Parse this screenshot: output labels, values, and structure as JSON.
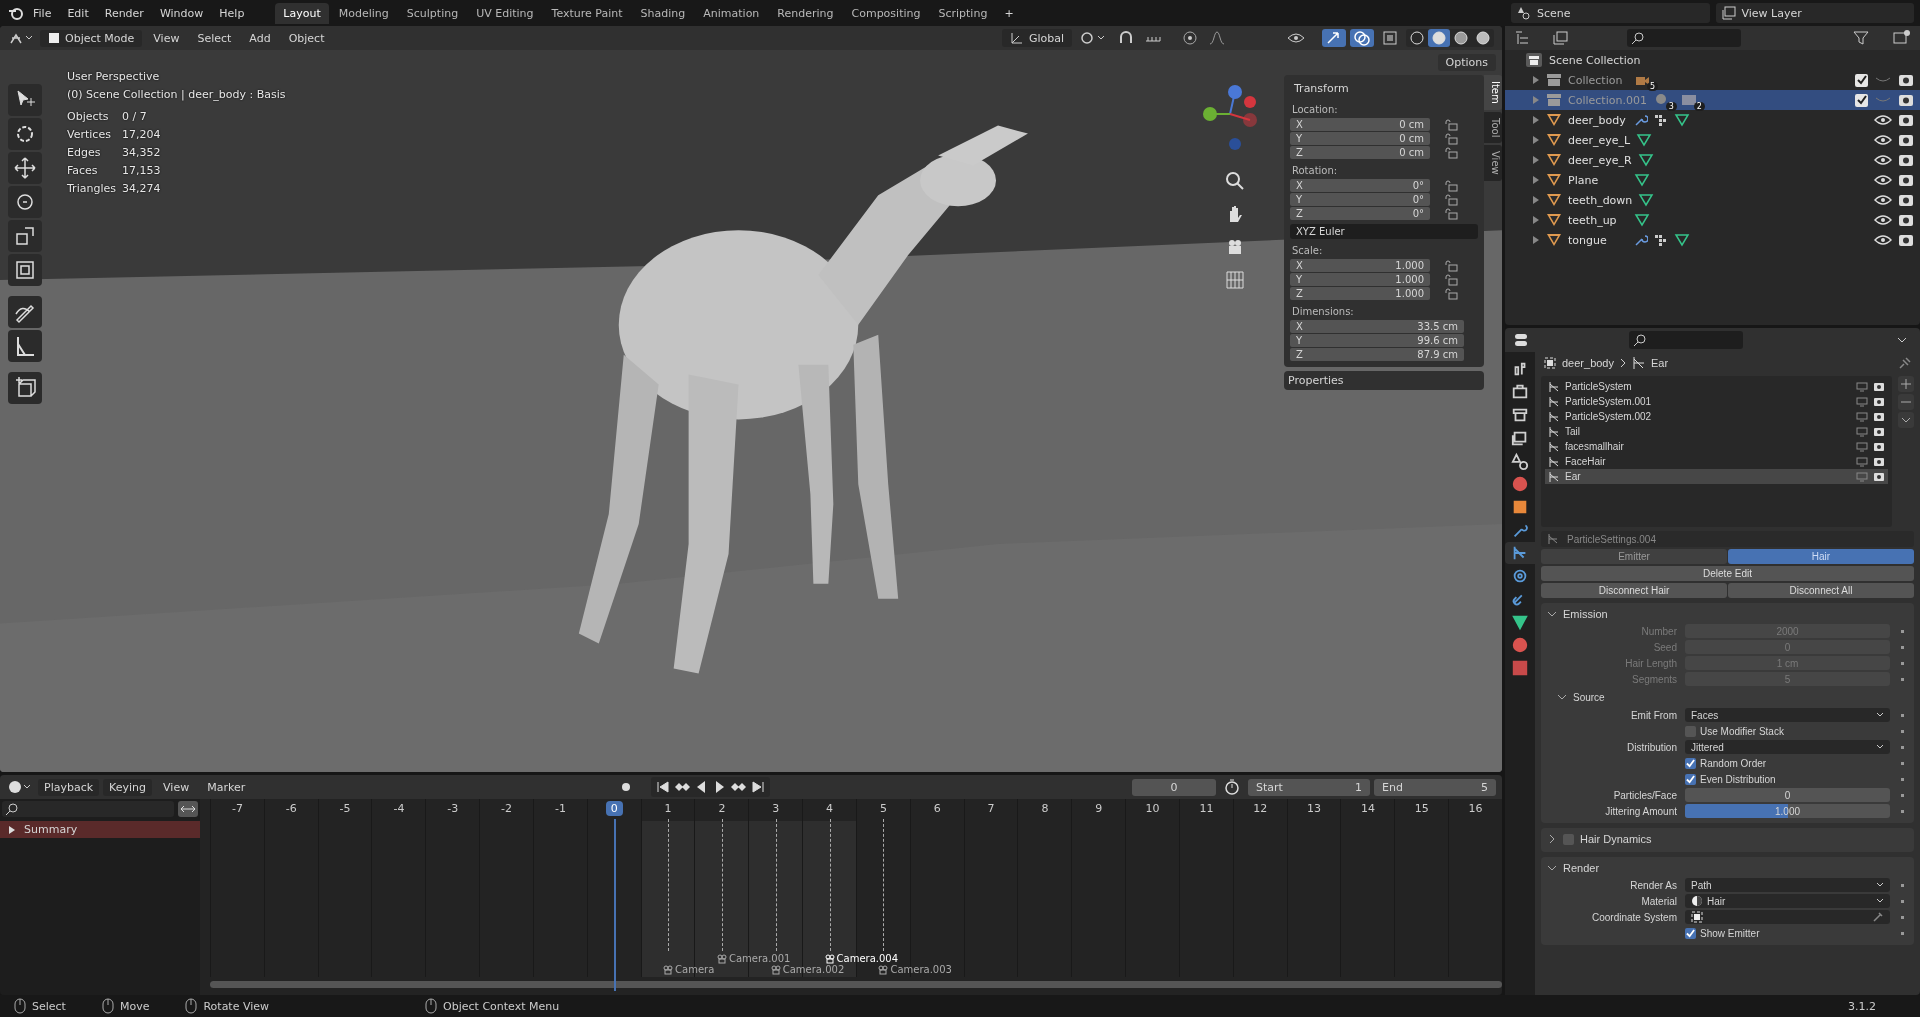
{
  "menu": [
    "File",
    "Edit",
    "Render",
    "Window",
    "Help"
  ],
  "workspaces": [
    {
      "label": "Layout",
      "selected": true
    },
    {
      "label": "Modeling",
      "selected": false
    },
    {
      "label": "Sculpting",
      "selected": false
    },
    {
      "label": "UV Editing",
      "selected": false
    },
    {
      "label": "Texture Paint",
      "selected": false
    },
    {
      "label": "Shading",
      "selected": false
    },
    {
      "label": "Animation",
      "selected": false
    },
    {
      "label": "Rendering",
      "selected": false
    },
    {
      "label": "Compositing",
      "selected": false
    },
    {
      "label": "Scripting",
      "selected": false
    }
  ],
  "add_workspace": "+",
  "scene": "Scene",
  "view_layer": "View Layer",
  "viewport_header": {
    "mode": "Object Mode",
    "menus": [
      "View",
      "Select",
      "Add",
      "Object"
    ],
    "orientation": "Global",
    "options": "Options",
    "shading": [
      {
        "kind": "wireframe",
        "selected": false
      },
      {
        "kind": "solid",
        "selected": true
      },
      {
        "kind": "material",
        "selected": false
      },
      {
        "kind": "rendered",
        "selected": false
      }
    ]
  },
  "viewport": {
    "perspective": "User Perspective",
    "context": "(0) Scene Collection | deer_body : Basis",
    "stats": [
      {
        "label": "Objects",
        "value": "0 / 7"
      },
      {
        "label": "Vertices",
        "value": "17,204"
      },
      {
        "label": "Edges",
        "value": "34,352"
      },
      {
        "label": "Faces",
        "value": "17,153"
      },
      {
        "label": "Triangles",
        "value": "34,274"
      }
    ]
  },
  "sidebar_tabs": [
    {
      "label": "Item",
      "selected": true
    },
    {
      "label": "Tool",
      "selected": false
    },
    {
      "label": "View",
      "selected": false
    }
  ],
  "transform": {
    "title": "Transform",
    "groups": [
      {
        "label": "Location:",
        "lock": true,
        "rows": [
          {
            "axis": "X",
            "value": "0 cm"
          },
          {
            "axis": "Y",
            "value": "0 cm"
          },
          {
            "axis": "Z",
            "value": "0 cm"
          }
        ]
      },
      {
        "label": "Rotation:",
        "lock": true,
        "rows": [
          {
            "axis": "X",
            "value": "0°"
          },
          {
            "axis": "Y",
            "value": "0°"
          },
          {
            "axis": "Z",
            "value": "0°"
          }
        ],
        "mode": "XYZ Euler"
      },
      {
        "label": "Scale:",
        "lock": true,
        "rows": [
          {
            "axis": "X",
            "value": "1.000"
          },
          {
            "axis": "Y",
            "value": "1.000"
          },
          {
            "axis": "Z",
            "value": "1.000"
          }
        ]
      },
      {
        "label": "Dimensions:",
        "lock": false,
        "rows": [
          {
            "axis": "X",
            "value": "33.5 cm"
          },
          {
            "axis": "Y",
            "value": "99.6 cm"
          },
          {
            "axis": "Z",
            "value": "87.9 cm"
          }
        ]
      }
    ]
  },
  "properties_panel": "Properties",
  "outliner": {
    "root": "Scene Collection",
    "items": [
      {
        "name": "Collection",
        "kind": "collection",
        "selected": false,
        "enabled": true,
        "badges": [
          {
            "kind": "camera",
            "count": "5"
          }
        ]
      },
      {
        "name": "Collection.001",
        "kind": "collection",
        "selected": true,
        "enabled": true,
        "badges": [
          {
            "kind": "light",
            "count": "3"
          },
          {
            "kind": "collection",
            "count": "2"
          }
        ]
      },
      {
        "name": "deer_body",
        "kind": "object",
        "selected": false,
        "modifiers": true
      },
      {
        "name": "deer_eye_L",
        "kind": "object",
        "selected": false,
        "modifiers": false
      },
      {
        "name": "deer_eye_R",
        "kind": "object",
        "selected": false,
        "modifiers": false
      },
      {
        "name": "Plane",
        "kind": "object",
        "selected": false,
        "modifiers": false
      },
      {
        "name": "teeth_down",
        "kind": "object",
        "selected": false,
        "modifiers": false
      },
      {
        "name": "teeth_up",
        "kind": "object",
        "selected": false,
        "modifiers": false
      },
      {
        "name": "tongue",
        "kind": "object",
        "selected": false,
        "modifiers": true
      }
    ]
  },
  "property_tabs": [
    {
      "kind": "tool",
      "selected": false
    },
    {
      "kind": "render",
      "selected": false
    },
    {
      "kind": "output",
      "selected": false
    },
    {
      "kind": "view_layer",
      "selected": false
    },
    {
      "kind": "scene",
      "selected": false
    },
    {
      "kind": "world",
      "selected": false
    },
    {
      "kind": "object",
      "selected": false
    },
    {
      "kind": "modifiers",
      "selected": false
    },
    {
      "kind": "particles",
      "selected": true
    },
    {
      "kind": "physics",
      "selected": false
    },
    {
      "kind": "constraints",
      "selected": false
    },
    {
      "kind": "data",
      "selected": false
    },
    {
      "kind": "material",
      "selected": false
    },
    {
      "kind": "texture",
      "selected": false
    }
  ],
  "breadcrumb": [
    "deer_body",
    "Ear"
  ],
  "particle_systems": [
    {
      "name": "ParticleSystem",
      "selected": false
    },
    {
      "name": "ParticleSystem.001",
      "selected": false
    },
    {
      "name": "ParticleSystem.002",
      "selected": false
    },
    {
      "name": "Tail",
      "selected": false
    },
    {
      "name": "facesmallhair",
      "selected": false
    },
    {
      "name": "FaceHair",
      "selected": false
    },
    {
      "name": "Ear",
      "selected": true
    }
  ],
  "particle_settings": "ParticleSettings.004",
  "particle_type": [
    {
      "label": "Emitter",
      "selected": false
    },
    {
      "label": "Hair",
      "selected": true
    }
  ],
  "edit_buttons": [
    "Delete Edit"
  ],
  "disconnect_buttons": [
    "Disconnect Hair",
    "Disconnect All"
  ],
  "sections": [
    {
      "title": "Emission",
      "expanded": true,
      "rows": [
        {
          "kind": "number",
          "label": "Number",
          "value": "2000",
          "disabled": true
        },
        {
          "kind": "number",
          "label": "Seed",
          "value": "0",
          "disabled": true
        },
        {
          "kind": "number",
          "label": "Hair Length",
          "value": "1 cm",
          "disabled": true
        },
        {
          "kind": "number",
          "label": "Segments",
          "value": "5",
          "disabled": true
        },
        {
          "kind": "subheader",
          "label": "Source",
          "expanded": true
        },
        {
          "kind": "dropdown",
          "label": "Emit From",
          "value": "Faces",
          "disabled": false
        },
        {
          "kind": "checkbox",
          "label": "Use Modifier Stack",
          "checked": false,
          "disabled": false
        },
        {
          "kind": "dropdown",
          "label": "Distribution",
          "value": "Jittered",
          "disabled": false
        },
        {
          "kind": "checkbox",
          "label": "Random Order",
          "checked": true,
          "disabled": false
        },
        {
          "kind": "checkbox",
          "label": "Even Distribution",
          "checked": true,
          "disabled": false
        },
        {
          "kind": "number",
          "label": "Particles/Face",
          "value": "0",
          "disabled": false
        },
        {
          "kind": "slider",
          "label": "Jittering Amount",
          "value": "1.000",
          "level": 0.5,
          "disabled": false
        }
      ]
    },
    {
      "title": "Hair Dynamics",
      "expanded": false,
      "checkbox": false
    },
    {
      "title": "Render",
      "expanded": true,
      "rows": [
        {
          "kind": "dropdown",
          "label": "Render As",
          "value": "Path",
          "disabled": false
        },
        {
          "kind": "material",
          "label": "Material",
          "value": "Hair",
          "disabled": false
        },
        {
          "kind": "object",
          "label": "Coordinate System",
          "disabled": false
        },
        {
          "kind": "checkbox",
          "label": "Show Emitter",
          "checked": true,
          "disabled": false
        }
      ]
    }
  ],
  "timeline": {
    "menus": [
      "Playback",
      "Keying",
      "View",
      "Marker"
    ],
    "current_frame": "0",
    "start_label": "Start",
    "start": "1",
    "end_label": "End",
    "end": "5",
    "channel": "Summary",
    "ticks": [
      {
        "label": "-7",
        "selected": false,
        "in_range": false
      },
      {
        "label": "-6",
        "selected": false,
        "in_range": false
      },
      {
        "label": "-5",
        "selected": false,
        "in_range": false
      },
      {
        "label": "-4",
        "selected": false,
        "in_range": false
      },
      {
        "label": "-3",
        "selected": false,
        "in_range": false
      },
      {
        "label": "-2",
        "selected": false,
        "in_range": false
      },
      {
        "label": "-1",
        "selected": false,
        "in_range": false
      },
      {
        "label": "0",
        "selected": true,
        "in_range": false
      },
      {
        "label": "1",
        "selected": false,
        "in_range": true,
        "marker": {
          "name": "Camera",
          "selected": false
        }
      },
      {
        "label": "2",
        "selected": false,
        "in_range": true,
        "marker": {
          "name": "Camera.001",
          "selected": false
        }
      },
      {
        "label": "3",
        "selected": false,
        "in_range": true,
        "marker": {
          "name": "Camera.002",
          "selected": false
        }
      },
      {
        "label": "4",
        "selected": false,
        "in_range": true,
        "marker": {
          "name": "Camera.004",
          "selected": true
        }
      },
      {
        "label": "5",
        "selected": false,
        "in_range": false,
        "marker": {
          "name": "Camera.003",
          "selected": false
        }
      },
      {
        "label": "6",
        "selected": false,
        "in_range": false
      },
      {
        "label": "7",
        "selected": false,
        "in_range": false
      },
      {
        "label": "8",
        "selected": false,
        "in_range": false
      },
      {
        "label": "9",
        "selected": false,
        "in_range": false
      },
      {
        "label": "10",
        "selected": false,
        "in_range": false
      },
      {
        "label": "11",
        "selected": false,
        "in_range": false
      },
      {
        "label": "12",
        "selected": false,
        "in_range": false
      },
      {
        "label": "13",
        "selected": false,
        "in_range": false
      },
      {
        "label": "14",
        "selected": false,
        "in_range": false
      },
      {
        "label": "15",
        "selected": false,
        "in_range": false
      },
      {
        "label": "16",
        "selected": false,
        "in_range": false
      }
    ]
  },
  "status_bar": {
    "hints": [
      "Select",
      "Move",
      "Rotate View",
      "Object Context Menu"
    ],
    "version": "3.1.2"
  }
}
